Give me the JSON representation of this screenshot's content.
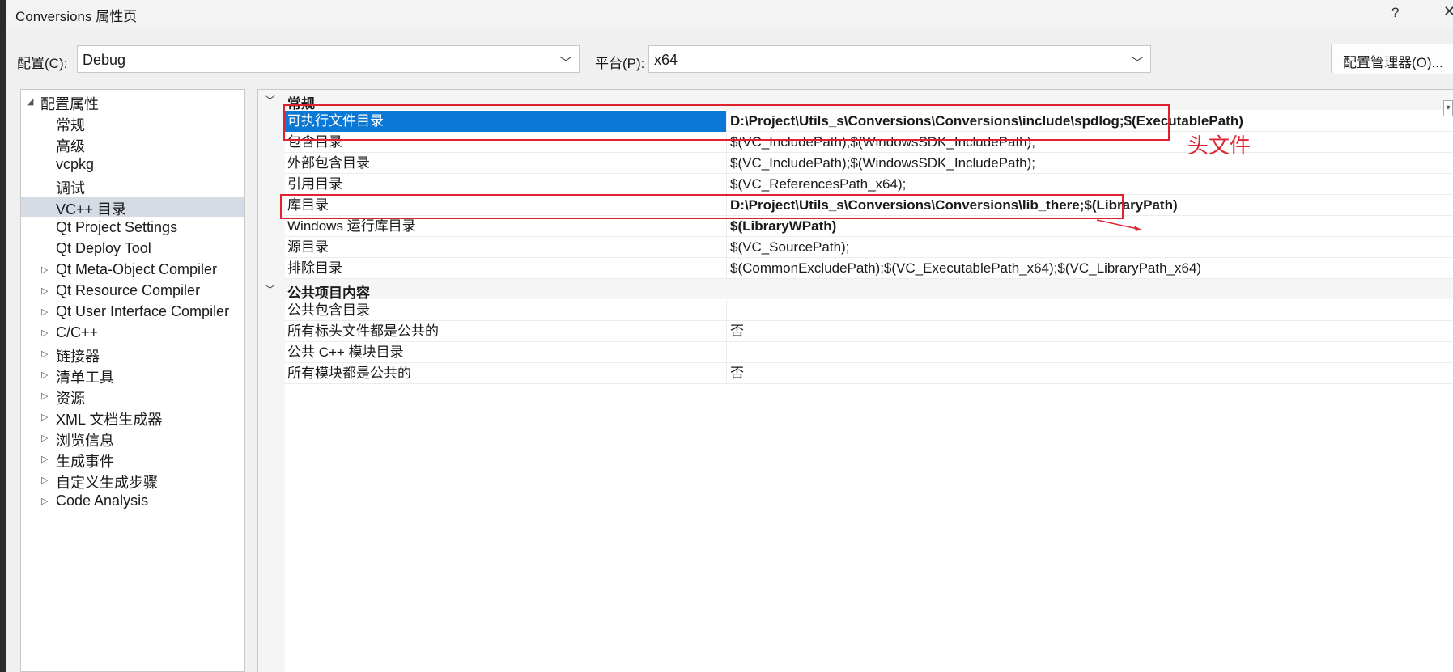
{
  "window": {
    "title": "Conversions 属性页",
    "help": "?",
    "close": "✕"
  },
  "config": {
    "config_label": "配置(C):",
    "config_value": "Debug",
    "platform_label": "平台(P):",
    "platform_value": "x64",
    "manager_button": "配置管理器(O)..."
  },
  "tree": {
    "root": "配置属性",
    "items": [
      {
        "label": "常规",
        "expandable": false
      },
      {
        "label": "高级",
        "expandable": false
      },
      {
        "label": "vcpkg",
        "expandable": false
      },
      {
        "label": "调试",
        "expandable": false
      },
      {
        "label": "VC++ 目录",
        "expandable": false,
        "selected": true
      },
      {
        "label": "Qt Project Settings",
        "expandable": false
      },
      {
        "label": "Qt Deploy Tool",
        "expandable": false
      },
      {
        "label": "Qt Meta-Object Compiler",
        "expandable": true
      },
      {
        "label": "Qt Resource Compiler",
        "expandable": true
      },
      {
        "label": "Qt User Interface Compiler",
        "expandable": true
      },
      {
        "label": "C/C++",
        "expandable": true
      },
      {
        "label": "链接器",
        "expandable": true
      },
      {
        "label": "清单工具",
        "expandable": true
      },
      {
        "label": "资源",
        "expandable": true
      },
      {
        "label": "XML 文档生成器",
        "expandable": true
      },
      {
        "label": "浏览信息",
        "expandable": true
      },
      {
        "label": "生成事件",
        "expandable": true
      },
      {
        "label": "自定义生成步骤",
        "expandable": true
      },
      {
        "label": "Code Analysis",
        "expandable": true
      }
    ]
  },
  "grid": {
    "sections": [
      {
        "title": "常规",
        "rows": [
          {
            "name": "可执行文件目录",
            "value": "D:\\Project\\Utils_s\\Conversions\\Conversions\\include\\spdlog;$(ExecutablePath)",
            "bold": true,
            "selected": true
          },
          {
            "name": "包含目录",
            "value": "$(VC_IncludePath);$(WindowsSDK_IncludePath);",
            "bold": false
          },
          {
            "name": "外部包含目录",
            "value": "$(VC_IncludePath);$(WindowsSDK_IncludePath);",
            "bold": false
          },
          {
            "name": "引用目录",
            "value": "$(VC_ReferencesPath_x64);",
            "bold": false
          },
          {
            "name": "库目录",
            "value": "D:\\Project\\Utils_s\\Conversions\\Conversions\\lib_there;$(LibraryPath)",
            "bold": true
          },
          {
            "name": "Windows 运行库目录",
            "value": "$(LibraryWPath)",
            "bold": true
          },
          {
            "name": "源目录",
            "value": "$(VC_SourcePath);",
            "bold": false
          },
          {
            "name": "排除目录",
            "value": "$(CommonExcludePath);$(VC_ExecutablePath_x64);$(VC_LibraryPath_x64)",
            "bold": false
          }
        ]
      },
      {
        "title": "公共项目内容",
        "rows": [
          {
            "name": "公共包含目录",
            "value": "",
            "bold": false
          },
          {
            "name": "所有标头文件都是公共的",
            "value": "否",
            "bold": false
          },
          {
            "name": "公共 C++ 模块目录",
            "value": "",
            "bold": false
          },
          {
            "name": "所有模块都是公共的",
            "value": "否",
            "bold": false
          }
        ]
      }
    ]
  },
  "annotation": {
    "text": "头文件",
    "color": "#e0212f"
  }
}
